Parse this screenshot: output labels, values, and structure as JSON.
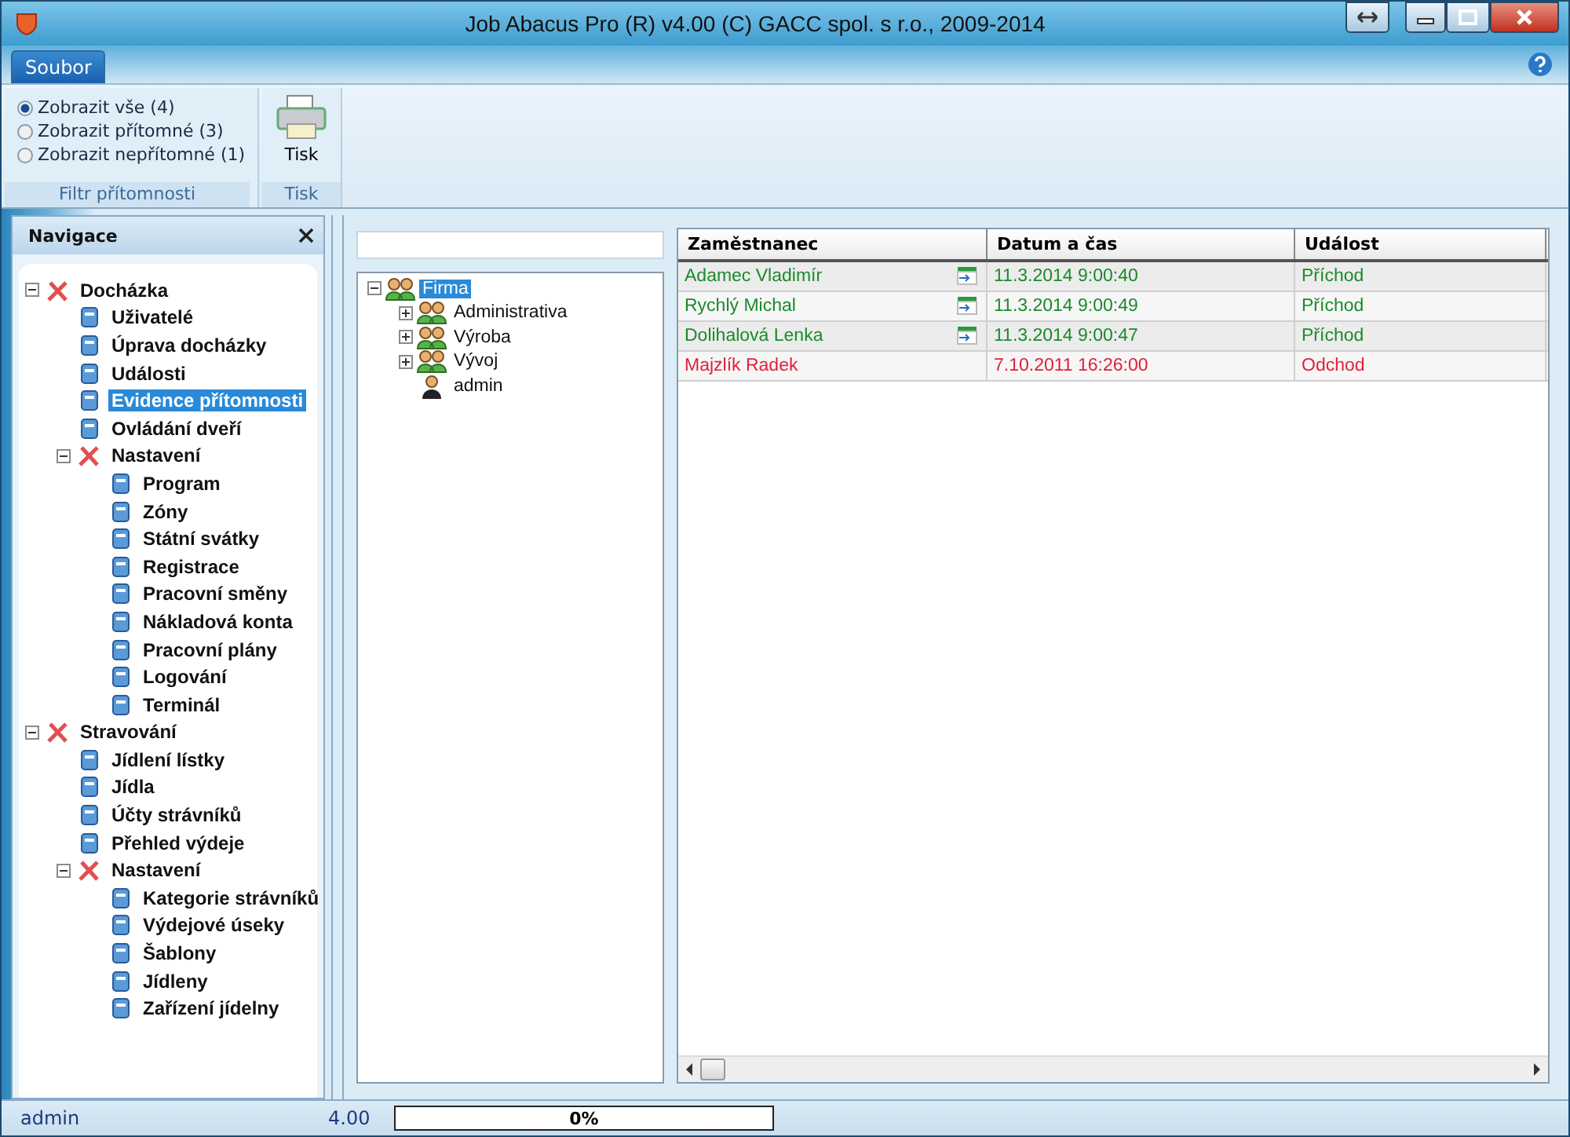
{
  "window": {
    "title": "Job Abacus Pro (R) v4.00 (C) GACC spol. s r.o., 2009-2014"
  },
  "menu_tabs": [
    {
      "label": "Soubor",
      "selected": true
    }
  ],
  "ribbon": {
    "groups": [
      {
        "kind": "radios",
        "label": "Filtr přítomnosti",
        "options": [
          {
            "label": "Zobrazit vše (4)",
            "selected": true
          },
          {
            "label": "Zobrazit přítomné (3)",
            "selected": false
          },
          {
            "label": "Zobrazit nepřítomné (1)",
            "selected": false
          }
        ]
      },
      {
        "kind": "buttons",
        "label": "Tisk",
        "buttons": [
          "Tisk"
        ]
      }
    ]
  },
  "nav": {
    "title": "Navigace",
    "items": [
      {
        "label": "Docházka",
        "expanded": true,
        "selected": false,
        "children": [
          {
            "label": "Uživatelé",
            "selected": false
          },
          {
            "label": "Úprava docházky",
            "selected": false
          },
          {
            "label": "Události",
            "selected": false
          },
          {
            "label": "Evidence přítomnosti",
            "selected": true
          },
          {
            "label": "Ovládání dveří",
            "selected": false
          },
          {
            "label": "Nastavení",
            "expanded": true,
            "selected": false,
            "children": [
              {
                "label": "Program",
                "selected": false
              },
              {
                "label": "Zóny",
                "selected": false
              },
              {
                "label": "Státní svátky",
                "selected": false
              },
              {
                "label": "Registrace",
                "selected": false
              },
              {
                "label": "Pracovní směny",
                "selected": false
              },
              {
                "label": "Nákladová konta",
                "selected": false
              },
              {
                "label": "Pracovní plány",
                "selected": false
              },
              {
                "label": "Logování",
                "selected": false
              },
              {
                "label": "Terminál",
                "selected": false
              }
            ]
          }
        ]
      },
      {
        "label": "Stravování",
        "expanded": true,
        "selected": false,
        "children": [
          {
            "label": "Jídlení lístky",
            "selected": false
          },
          {
            "label": "Jídla",
            "selected": false
          },
          {
            "label": "Účty strávníků",
            "selected": false
          },
          {
            "label": "Přehled výdeje",
            "selected": false
          },
          {
            "label": "Nastavení",
            "expanded": true,
            "selected": false,
            "children": [
              {
                "label": "Kategorie strávníků",
                "selected": false
              },
              {
                "label": "Výdejové úseky",
                "selected": false
              },
              {
                "label": "Šablony",
                "selected": false
              },
              {
                "label": "Jídleny",
                "selected": false
              },
              {
                "label": "Zařízení jídelny",
                "selected": false
              }
            ]
          }
        ]
      }
    ]
  },
  "org_tree": {
    "items": [
      {
        "label": "Firma",
        "kind": "group",
        "expanded": true,
        "selected": true,
        "children": [
          {
            "label": "Administrativa",
            "kind": "group",
            "expanded": false,
            "selected": false
          },
          {
            "label": "Výroba",
            "kind": "group",
            "expanded": false,
            "selected": false
          },
          {
            "label": "Vývoj",
            "kind": "group",
            "expanded": false,
            "selected": false
          },
          {
            "label": "admin",
            "kind": "user",
            "selected": false
          }
        ]
      }
    ]
  },
  "table": {
    "columns": [
      "Zaměstnanec",
      "Datum a čas",
      "Událost"
    ],
    "rows": [
      {
        "employee": "Adamec Vladimír",
        "terminal": true,
        "time": "11.3.2014 9:00:40",
        "event": "Příchod",
        "color": "#1a8a2a"
      },
      {
        "employee": "Rychlý Michal",
        "terminal": true,
        "time": "11.3.2014 9:00:49",
        "event": "Příchod",
        "color": "#1a8a2a"
      },
      {
        "employee": "Dolihalová Lenka",
        "terminal": true,
        "time": "11.3.2014 9:00:47",
        "event": "Příchod",
        "color": "#1a8a2a"
      },
      {
        "employee": "Majzlík Radek",
        "terminal": false,
        "time": "7.10.2011 16:26:00",
        "event": "Odchod",
        "color": "#e0203a"
      }
    ]
  },
  "status_bar": {
    "user": "admin",
    "version": "4.00",
    "progress": {
      "level": 0,
      "label": "0%"
    }
  }
}
